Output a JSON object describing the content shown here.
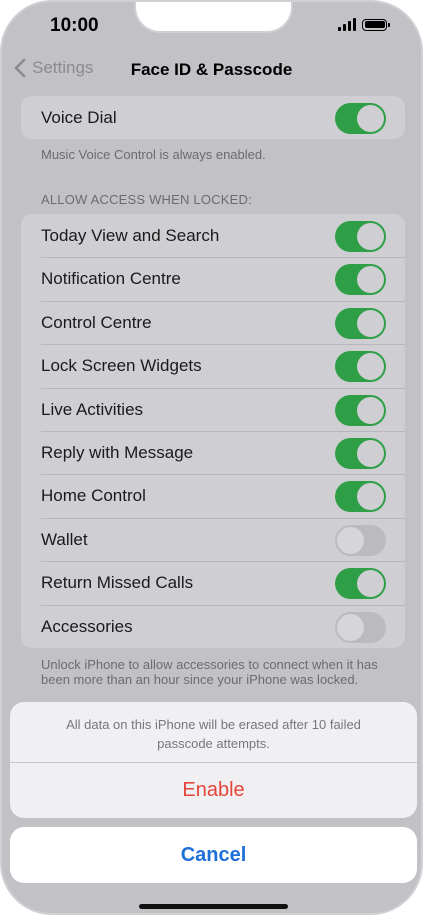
{
  "status_bar": {
    "time": "10:00"
  },
  "nav": {
    "back_label": "Settings",
    "title": "Face ID & Passcode"
  },
  "voice_dial": {
    "label": "Voice Dial",
    "on": true,
    "note": "Music Voice Control is always enabled."
  },
  "locked_section": {
    "header": "ALLOW ACCESS WHEN LOCKED:",
    "items": [
      {
        "label": "Today View and Search",
        "on": true
      },
      {
        "label": "Notification Centre",
        "on": true
      },
      {
        "label": "Control Centre",
        "on": true
      },
      {
        "label": "Lock Screen Widgets",
        "on": true
      },
      {
        "label": "Live Activities",
        "on": true
      },
      {
        "label": "Reply with Message",
        "on": true
      },
      {
        "label": "Home Control",
        "on": true
      },
      {
        "label": "Wallet",
        "on": false
      },
      {
        "label": "Return Missed Calls",
        "on": true
      },
      {
        "label": "Accessories",
        "on": false
      }
    ],
    "note": "Unlock iPhone to allow accessories to connect when it has been more than an hour since your iPhone was locked."
  },
  "action_sheet": {
    "message": "All data on this iPhone will be erased after 10 failed passcode attempts.",
    "enable_label": "Enable",
    "cancel_label": "Cancel"
  },
  "colors": {
    "toggle_on": "#2f9f47",
    "destructive": "#e5443a",
    "link": "#1f6fd8"
  }
}
